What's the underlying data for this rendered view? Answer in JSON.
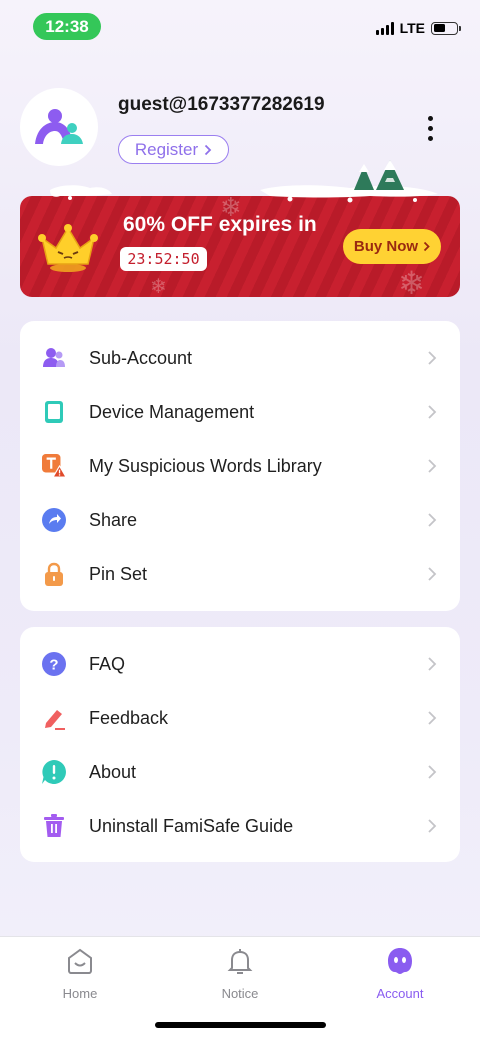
{
  "status_bar": {
    "time": "12:38",
    "network": "LTE"
  },
  "profile": {
    "username": "guest@1673377282619",
    "register_label": "Register",
    "avatar_icon": "family-logo-icon",
    "more_icon": "more-vertical-icon"
  },
  "promo": {
    "headline": "60% OFF expires in",
    "countdown": "23:52:50",
    "buy_label": "Buy Now",
    "background_color": "#c8202f",
    "button_color": "#ffd233"
  },
  "menu_group_1": [
    {
      "label": "Sub-Account",
      "icon": "users-icon"
    },
    {
      "label": "Device Management",
      "icon": "tablet-icon"
    },
    {
      "label": "My Suspicious Words Library",
      "icon": "text-warning-icon"
    },
    {
      "label": "Share",
      "icon": "share-icon"
    },
    {
      "label": "Pin Set",
      "icon": "lock-icon"
    }
  ],
  "menu_group_2": [
    {
      "label": "FAQ",
      "icon": "question-icon"
    },
    {
      "label": "Feedback",
      "icon": "pen-icon"
    },
    {
      "label": "About",
      "icon": "info-icon"
    },
    {
      "label": "Uninstall FamiSafe Guide",
      "icon": "trash-icon"
    }
  ],
  "bottom_nav": [
    {
      "label": "Home",
      "icon": "home-icon",
      "active": false
    },
    {
      "label": "Notice",
      "icon": "bell-icon",
      "active": false
    },
    {
      "label": "Account",
      "icon": "account-ghost-icon",
      "active": true
    }
  ],
  "colors": {
    "accent": "#8a5cf0",
    "status_green": "#34c759"
  }
}
